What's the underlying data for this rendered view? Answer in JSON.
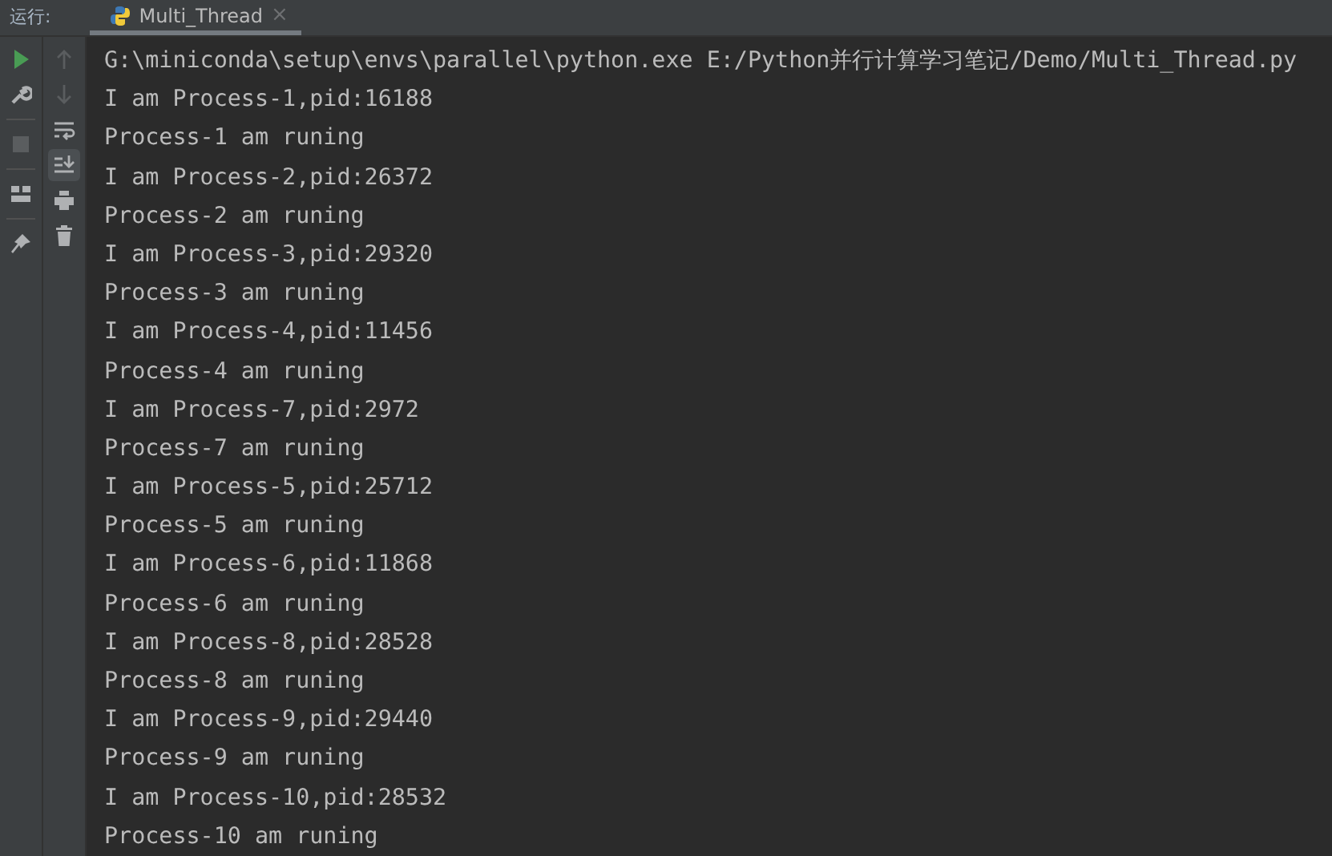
{
  "run_label": "运行:",
  "tab": {
    "title": "Multi_Thread",
    "close": "×",
    "selected": true
  },
  "left_toolbar": [
    {
      "kind": "run",
      "disabled": false
    },
    {
      "kind": "wrench",
      "disabled": false
    },
    {
      "kind": "stop",
      "disabled": true
    },
    {
      "kind": "layout",
      "disabled": false
    },
    {
      "kind": "pin",
      "disabled": false
    }
  ],
  "right_toolbar": [
    {
      "kind": "up",
      "disabled": true,
      "selected": false
    },
    {
      "kind": "down",
      "disabled": true,
      "selected": false
    },
    {
      "kind": "wrap",
      "disabled": false,
      "selected": false
    },
    {
      "kind": "scroll",
      "disabled": false,
      "selected": true
    },
    {
      "kind": "print",
      "disabled": false,
      "selected": false
    },
    {
      "kind": "trash",
      "disabled": false,
      "selected": false
    }
  ],
  "console_lines": [
    "G:\\miniconda\\setup\\envs\\parallel\\python.exe E:/Python并行计算学习笔记/Demo/Multi_Thread.py",
    "I am Process-1,pid:16188",
    "Process-1 am runing",
    "I am Process-2,pid:26372",
    "Process-2 am runing",
    "I am Process-3,pid:29320",
    "Process-3 am runing",
    "I am Process-4,pid:11456",
    "Process-4 am runing",
    "I am Process-7,pid:2972",
    "Process-7 am runing",
    "I am Process-5,pid:25712",
    "Process-5 am runing",
    "I am Process-6,pid:11868",
    "Process-6 am runing",
    "I am Process-8,pid:28528",
    "Process-8 am runing",
    "I am Process-9,pid:29440",
    "Process-9 am runing",
    "I am Process-10,pid:28532",
    "Process-10 am runing"
  ]
}
